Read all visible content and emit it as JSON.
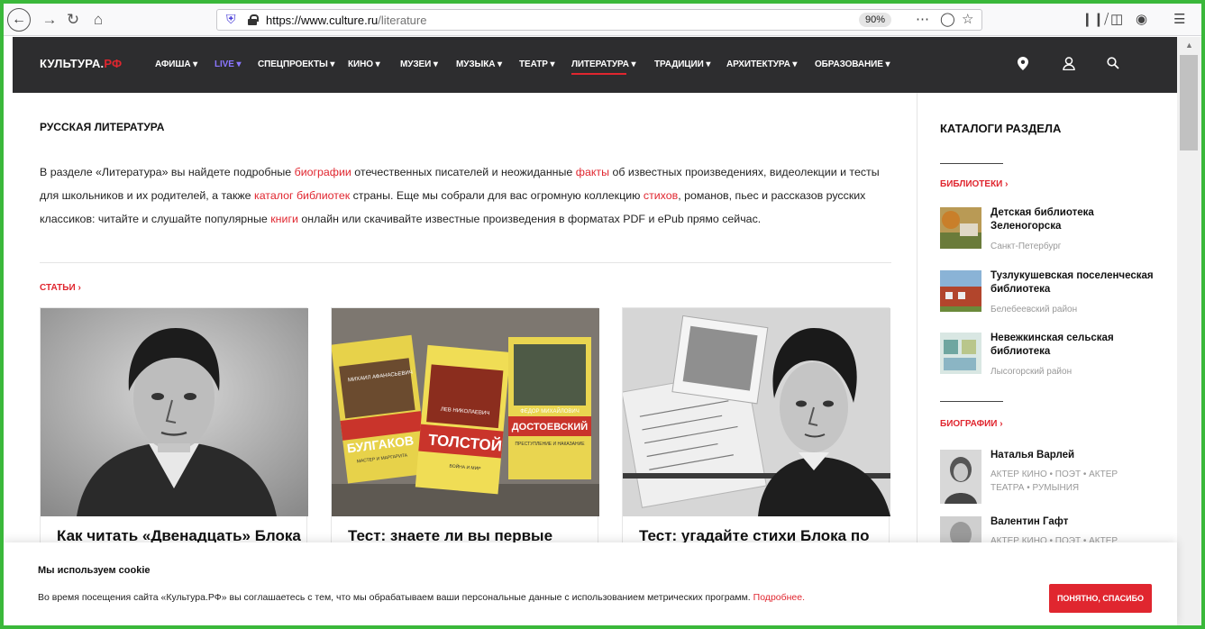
{
  "browser": {
    "url_host": "https://www.culture.ru",
    "url_path": "/literature",
    "zoom": "90%"
  },
  "site": {
    "logo_main": "КУЛЬТУРА.",
    "logo_accent": "РФ",
    "menu": [
      "АФИША",
      "LIVE",
      "СПЕЦПРОЕКТЫ",
      "КИНО",
      "МУЗЕИ",
      "МУЗЫКА",
      "ТЕАТР",
      "ЛИТЕРАТУРА",
      "ТРАДИЦИИ",
      "АРХИТЕКТУРА",
      "ОБРАЗОВАНИЕ"
    ],
    "active_menu": "ЛИТЕРАТУРА",
    "accent_color": "#e0262f",
    "live_color": "#8a76ff"
  },
  "main": {
    "title": "РУССКАЯ ЛИТЕРАТУРА",
    "intro": [
      "В разделе «Литература» вы найдете подробные ",
      "биографии",
      " отечественных писателей и неожиданные ",
      "факты",
      " об известных произведениях, видеолекции и тесты для школьников и их родителей, а также ",
      "каталог библиотек",
      " страны. Еще мы собрали для вас огромную коллекцию ",
      "стихов",
      ", романов, пьес и рассказов русских классиков: читайте и слушайте популярные ",
      "книги",
      " онлайн или скачивайте известные произведения в форматах PDF и ePub прямо сейчас."
    ],
    "articles_label": "СТАТЬИ",
    "cards": [
      {
        "title": "Как читать «Двенадцать» Блока"
      },
      {
        "title": "Тест: знаете ли вы первые"
      },
      {
        "title": "Тест: угадайте стихи Блока по"
      }
    ],
    "book_covers": [
      {
        "author": "МИХАИЛ АФАНАСЬЕВИЧ",
        "name": "БУЛГАКОВ",
        "work": "МАСТЕР И МАРГАРИТА"
      },
      {
        "author": "ЛЕВ НИКОЛАЕВИЧ",
        "name": "ТОЛСТОЙ",
        "work": "ВОЙНА И МИР"
      },
      {
        "author": "ФЕДОР МИХАЙЛОВИЧ",
        "name": "ДОСТОЕВСКИЙ",
        "work": "ПРЕСТУПЛЕНИЕ И НАКАЗАНИЕ"
      }
    ]
  },
  "aside": {
    "title": "КАТАЛОГИ РАЗДЕЛА",
    "libraries_label": "БИБЛИОТЕКИ",
    "libraries": [
      {
        "name": "Детская библиотека Зеленогорска",
        "place": "Санкт-Петербург"
      },
      {
        "name": "Тузлукушевская поселенческая библиотека",
        "place": "Белебеевский район"
      },
      {
        "name": "Невежкинская сельская библиотека",
        "place": "Лысогорский район"
      }
    ],
    "bios_label": "БИОГРАФИИ",
    "bios": [
      {
        "name": "Наталья Варлей",
        "roles": "АКТЕР КИНО • ПОЭТ • АКТЕР ТЕАТРА • РУМЫНИЯ"
      },
      {
        "name": "Валентин Гафт",
        "roles": "АКТЕР КИНО • ПОЭТ • АКТЕР"
      }
    ]
  },
  "cookie": {
    "title": "Мы используем cookie",
    "text": "Во время посещения сайта «Культура.РФ» вы соглашаетесь с тем, что мы обрабатываем ваши персональные данные с использованием метрических программ. ",
    "link": "Подробнее.",
    "button": "ПОНЯТНО, СПАСИБО"
  }
}
